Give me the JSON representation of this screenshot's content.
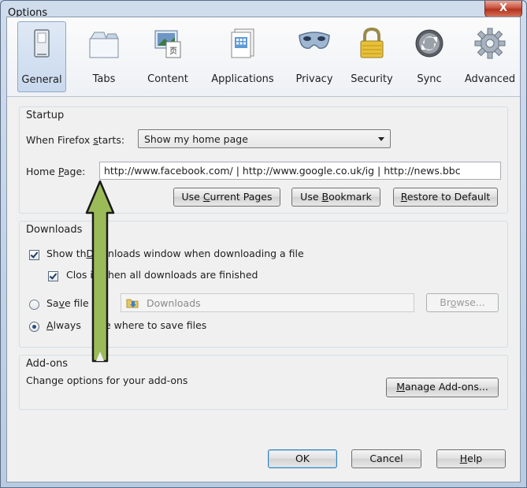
{
  "window": {
    "title": "Options",
    "close_symbol": "X"
  },
  "toolbar": {
    "tabs": [
      {
        "label": "General",
        "icon": "general-icon",
        "selected": true
      },
      {
        "label": "Tabs",
        "icon": "tabs-icon"
      },
      {
        "label": "Content",
        "icon": "content-icon"
      },
      {
        "label": "Applications",
        "icon": "applications-icon"
      },
      {
        "label": "Privacy",
        "icon": "privacy-mask-icon"
      },
      {
        "label": "Security",
        "icon": "padlock-icon"
      },
      {
        "label": "Sync",
        "icon": "sync-icon"
      },
      {
        "label": "Advanced",
        "icon": "gear-icon"
      }
    ]
  },
  "startup": {
    "title": "Startup",
    "when_starts_label_pre": "When Firefox ",
    "when_starts_label_ul": "s",
    "when_starts_label_post": "tarts:",
    "when_starts_value": "Show my home page",
    "home_page_label_pre": "Home ",
    "home_page_label_ul": "P",
    "home_page_label_post": "age:",
    "home_page_value": "http://www.facebook.com/ | http://www.google.co.uk/ig | http://news.bbc",
    "use_current_pre": "Use ",
    "use_current_ul": "C",
    "use_current_post": "urrent Pages",
    "use_bookmark_pre": "Use ",
    "use_bookmark_ul": "B",
    "use_bookmark_post": "ookmark",
    "restore_ul": "R",
    "restore_post": "estore to Default"
  },
  "downloads": {
    "title": "Downloads",
    "show_window_pre": "Show th",
    "show_window_ul": "D",
    "show_window_post": "ownloads window when downloading a file",
    "close_pre": "Clos",
    "close_gap": " it ",
    "close_ul": "w",
    "close_post": "hen all downloads are finished",
    "save_pre": "Sa",
    "save_ul": "v",
    "save_post": "e file",
    "save_to": "o",
    "folder_name": "Downloads",
    "browse_pre": "Br",
    "browse_ul": "o",
    "browse_post": "wse...",
    "always_ul": "A",
    "always_pre": "lways ",
    "always_post": " me where to save files"
  },
  "addons": {
    "title": "Add-ons",
    "description": "Change options for your add-ons",
    "manage_ul": "M",
    "manage_post": "anage Add-ons..."
  },
  "footer": {
    "ok_label": "OK",
    "cancel_label": "Cancel",
    "help_ul": "H",
    "help_post": "elp"
  },
  "colors": {
    "arrow_fill": "#9bbb59",
    "selected_tab": "#c9d9ee",
    "close_button": "#c85440"
  }
}
